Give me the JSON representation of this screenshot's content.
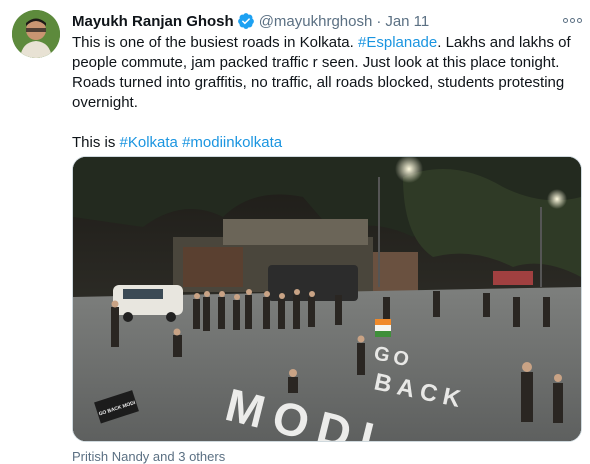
{
  "tweet": {
    "author": {
      "display_name": "Mayukh Ranjan Ghosh",
      "handle": "@mayukhrghosh",
      "verified": true,
      "avatar_icon": "user-avatar"
    },
    "separator": "·",
    "date": "Jan 11",
    "body": {
      "part1": "This is one of the busiest roads in Kolkata. ",
      "hashtag1": "#Esplanade",
      "part2": ". Lakhs and lakhs of people commute, jam packed traffic r seen. Just look at this place tonight. Roads turned into graffitis, no traffic, all roads blocked, students protesting overnight.",
      "line2_prefix": "This is ",
      "hashtag2": "#Kolkata",
      "hashtag3": "#modiinkolkata"
    },
    "photo": {
      "road_text": [
        "GO",
        "BACK",
        "MODI"
      ],
      "small_sign": "GO BACK MODI"
    },
    "footer_text": "Pritish Nandy and 3 others",
    "more_icon": "ellipsis-icon",
    "colors": {
      "link": "#1b95e0",
      "muted": "#5b7083",
      "verified": "#1da1f2"
    }
  }
}
